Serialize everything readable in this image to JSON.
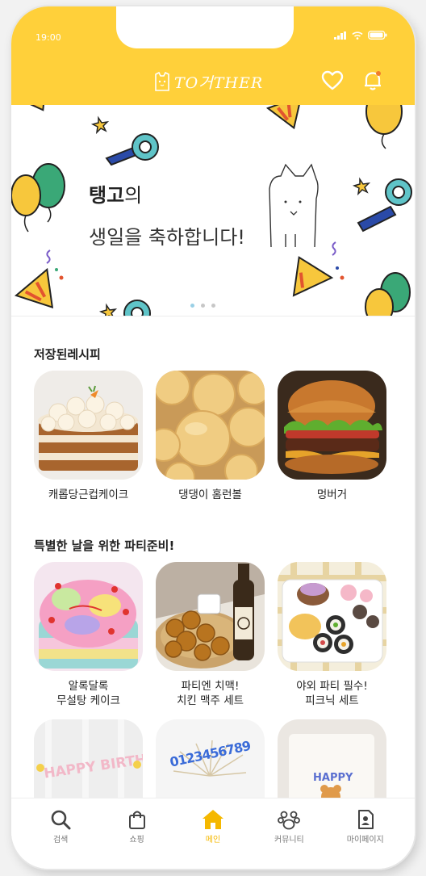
{
  "status_bar": {
    "time": "19:00"
  },
  "header": {
    "logo_text": "TO거THER"
  },
  "banner": {
    "name": "탱고",
    "name_suffix": "의",
    "message": "생일을 축하합니다!",
    "page_count": 3,
    "active_page": 1
  },
  "saved_recipes": {
    "title": "저장된레시피",
    "items": [
      {
        "label": "캐롭당근컵케이크"
      },
      {
        "label": "댕댕이 홈런볼"
      },
      {
        "label": "멍버거"
      }
    ]
  },
  "party_prep": {
    "title": "특별한 날을 위한 파티준비!",
    "items": [
      {
        "label": "알록달록\n무설탕 케이크"
      },
      {
        "label": "파티엔 치맥!\n치킨 맥주 세트"
      },
      {
        "label": "야외 파티 필수!\n피크닉 세트"
      }
    ]
  },
  "more_row": {
    "items": [
      {
        "label": "HAPPY BIRTHDAY"
      },
      {
        "label": "0123456789"
      },
      {
        "label": "HAPPY"
      }
    ]
  },
  "tabbar": {
    "items": [
      {
        "label": "검색",
        "icon": "search-icon"
      },
      {
        "label": "쇼핑",
        "icon": "shopping-bag-icon"
      },
      {
        "label": "메인",
        "icon": "home-icon",
        "active": true
      },
      {
        "label": "커뮤니티",
        "icon": "paw-icon"
      },
      {
        "label": "마이페이지",
        "icon": "profile-icon"
      }
    ]
  },
  "colors": {
    "accent": "#ffd03a",
    "active_tab": "#f5b800"
  }
}
